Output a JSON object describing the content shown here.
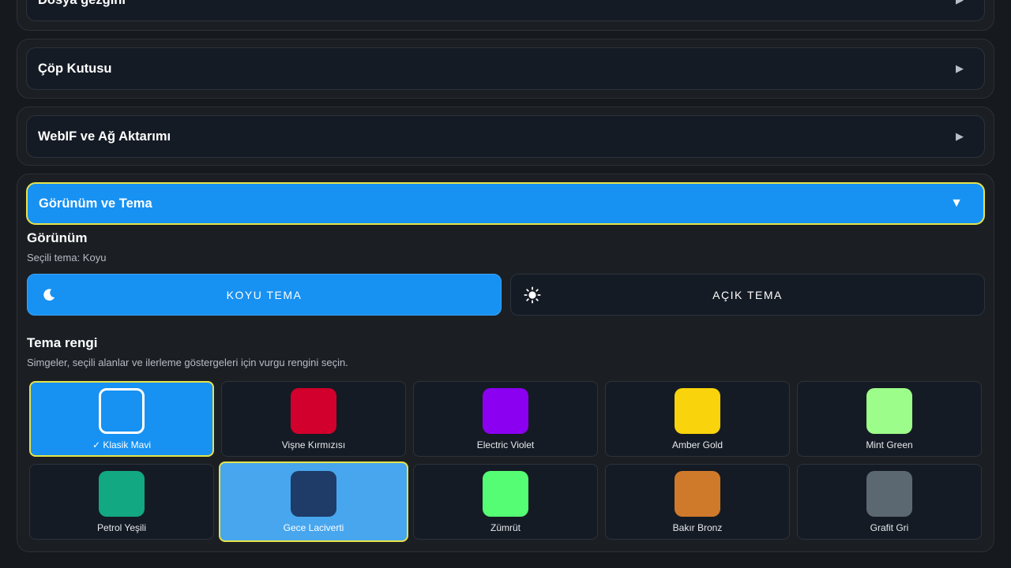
{
  "sections": {
    "file_browser": {
      "title": "Dosya gezgini",
      "arrow": "▶"
    },
    "trash": {
      "title": "Çöp Kutusu",
      "arrow": "▶"
    },
    "webif": {
      "title": "WebIF ve Ağ Aktarımı",
      "arrow": "▶"
    },
    "appearance": {
      "title": "Görünüm ve Tema",
      "arrow": "▼"
    }
  },
  "appearance": {
    "heading": "Görünüm",
    "selected_text": "Seçili tema: Koyu",
    "dark_label": "KOYU TEMA",
    "light_label": "AÇIK TEMA",
    "color_heading": "Tema rengi",
    "color_desc": "Simgeler, seçili alanlar ve ilerleme göstergeleri için vurgu rengini seçin."
  },
  "swatches": [
    {
      "label": "✓ Klasik Mavi",
      "color": "#1791f2"
    },
    {
      "label": "Vişne Kırmızısı",
      "color": "#d1002c"
    },
    {
      "label": "Electric Violet",
      "color": "#8b00f0"
    },
    {
      "label": "Amber Gold",
      "color": "#f9d30c"
    },
    {
      "label": "Mint Green",
      "color": "#9dfd8a"
    },
    {
      "label": "Petrol Yeşili",
      "color": "#12a882"
    },
    {
      "label": "Gece Laciverti",
      "color": "#1f3b67"
    },
    {
      "label": "Zümrüt",
      "color": "#55fd74"
    },
    {
      "label": "Bakır Bronz",
      "color": "#cf7a2b"
    },
    {
      "label": "Grafit Gri",
      "color": "#5b6872"
    }
  ]
}
